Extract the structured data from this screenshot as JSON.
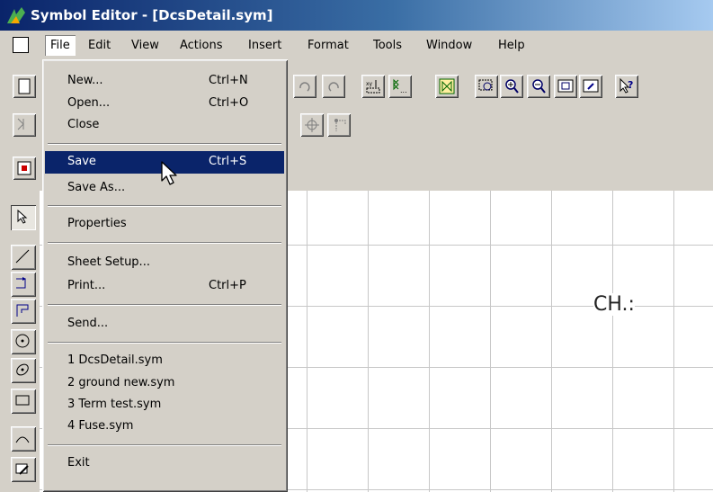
{
  "window": {
    "title": "Symbol Editor - [DcsDetail.sym]"
  },
  "menubar": {
    "items": [
      "File",
      "Edit",
      "View",
      "Actions",
      "Insert",
      "Format",
      "Tools",
      "Window",
      "Help"
    ]
  },
  "file_menu": {
    "new": {
      "label": "New...",
      "shortcut": "Ctrl+N"
    },
    "open": {
      "label": "Open...",
      "shortcut": "Ctrl+O"
    },
    "close": {
      "label": "Close"
    },
    "save": {
      "label": "Save",
      "shortcut": "Ctrl+S"
    },
    "save_as": {
      "label": "Save As..."
    },
    "properties": {
      "label": "Properties"
    },
    "sheet_setup": {
      "label": "Sheet Setup..."
    },
    "print": {
      "label": "Print...",
      "shortcut": "Ctrl+P"
    },
    "send": {
      "label": "Send..."
    },
    "recent": [
      "1 DcsDetail.sym",
      "2 ground new.sym",
      "3 Term test.sym",
      "4 Fuse.sym"
    ],
    "exit": {
      "label": "Exit"
    }
  },
  "canvas": {
    "text": "CH.:"
  },
  "colors": {
    "highlight": "#0a246a",
    "chrome": "#d4d0c8",
    "grid": "#c7c7c7"
  }
}
